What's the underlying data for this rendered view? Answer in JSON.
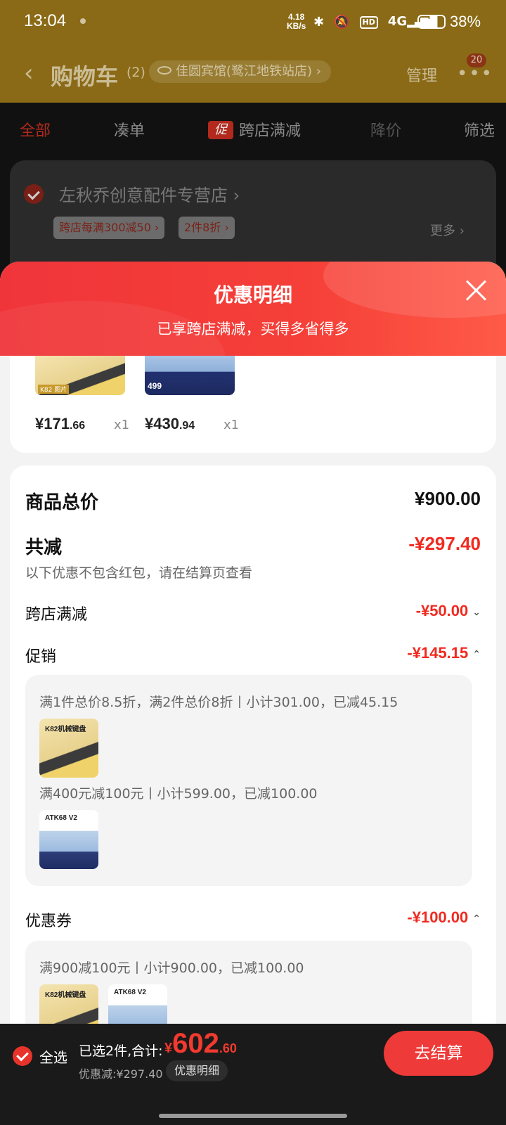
{
  "status": {
    "time": "13:04",
    "net_speed_value": "4.18",
    "net_speed_unit": "KB/s",
    "hd_label": "HD",
    "network_type": "4G",
    "battery_percent": "38%",
    "battery_level": 0.38
  },
  "header": {
    "back_icon": "‹",
    "title": "购物车",
    "count": "(2)",
    "location": "佳圆宾馆(鹭江地铁站店) ›",
    "manage": "管理",
    "more_icon": "•••",
    "badge": "20"
  },
  "tabs": [
    {
      "label": "全部"
    },
    {
      "label": "凑单"
    },
    {
      "label": "跨店满减",
      "icon_text": "促"
    },
    {
      "label": "降价"
    },
    {
      "label": "筛选"
    }
  ],
  "store": {
    "name": "左秋乔创意配件专营店 ›",
    "tags": [
      "跨店每满300减50 ›",
      "2件8折 ›"
    ],
    "more": "更多 ›"
  },
  "sheet": {
    "title": "优惠明细",
    "subtitle": "已享跨店满减，买得多省得多",
    "goods": [
      {
        "thumb_label": "K82 图片",
        "price_int": "¥171",
        "price_dec": ".66",
        "qty": "x1",
        "image": "yellow-keyboard"
      },
      {
        "thumb_label": "499",
        "price_int": "¥430",
        "price_dec": ".94",
        "qty": "x1",
        "image": "blue-keyboard"
      }
    ],
    "total_label": "商品总价",
    "total_value": "¥900.00",
    "reduce_label": "共减",
    "reduce_value": "-¥297.40",
    "reduce_note": "以下优惠不包含红包，请在结算页查看",
    "cross_label": "跨店满减",
    "cross_value": "-¥50.00",
    "promo_label": "促销",
    "promo_value": "-¥145.15",
    "promo_line1": "满1件总价8.5折，满2件总价8折丨小计301.00，已减45.15",
    "promo_img1_caption": "K82机械键盘",
    "promo_line2": "满400元减100元丨小计599.00，已减100.00",
    "promo_img2_caption": "ATK68 V2",
    "coupon_label": "优惠券",
    "coupon_value": "-¥100.00",
    "coupon_line": "满900减100元丨小计900.00，已减100.00",
    "caret_down": "⌄",
    "caret_up": "⌃"
  },
  "bottom": {
    "select_all": "全选",
    "selected": "已选2件,合计:",
    "total_symbol": "¥",
    "total_int": "602",
    "total_dec": ".60",
    "discount": "优惠减:¥297.40",
    "detail_button": "优惠明细",
    "checkout": "去结算"
  }
}
